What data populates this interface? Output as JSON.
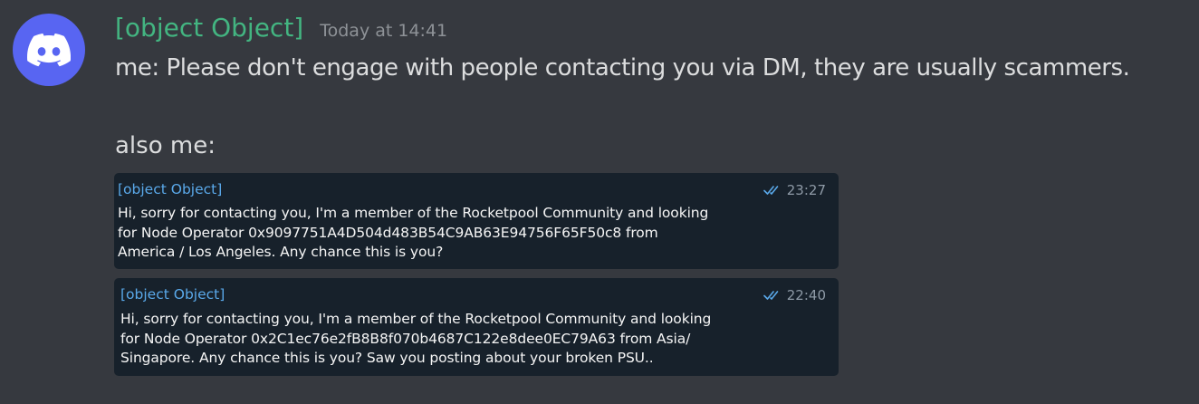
{
  "message": {
    "author": "[object Object]",
    "timestamp": "Today at 14:41",
    "avatar_icon": "discord-logo-icon",
    "line1": "me: Please don't engage with people contacting you via DM, they are usually scammers.",
    "line2": "also me:"
  },
  "screenshots": [
    {
      "sender": "[object Object]",
      "time": "23:27",
      "read_icon": "double-check-icon",
      "lines": [
        "Hi, sorry for contacting you, I'm a member of the Rocketpool Community and looking",
        "for Node Operator 0x9097751A4D504d483B54C9AB63E94756F65F50c8 from",
        "America / Los Angeles. Any chance this is you?"
      ]
    },
    {
      "sender": "[object Object]",
      "time": "22:40",
      "read_icon": "double-check-icon",
      "lines": [
        "Hi, sorry for contacting you, I'm a member of the Rocketpool Community and looking",
        "for Node Operator 0x2C1ec76e2fB8B8f070b4687C122e8dee0EC79A63 from Asia/",
        "Singapore. Any chance this is you? Saw you posting about your broken PSU.."
      ]
    }
  ],
  "colors": {
    "background": "#36393f",
    "username": "#43b581",
    "avatar": "#5865f2",
    "card": "#17212b",
    "tg_name": "#5aa9ea"
  }
}
